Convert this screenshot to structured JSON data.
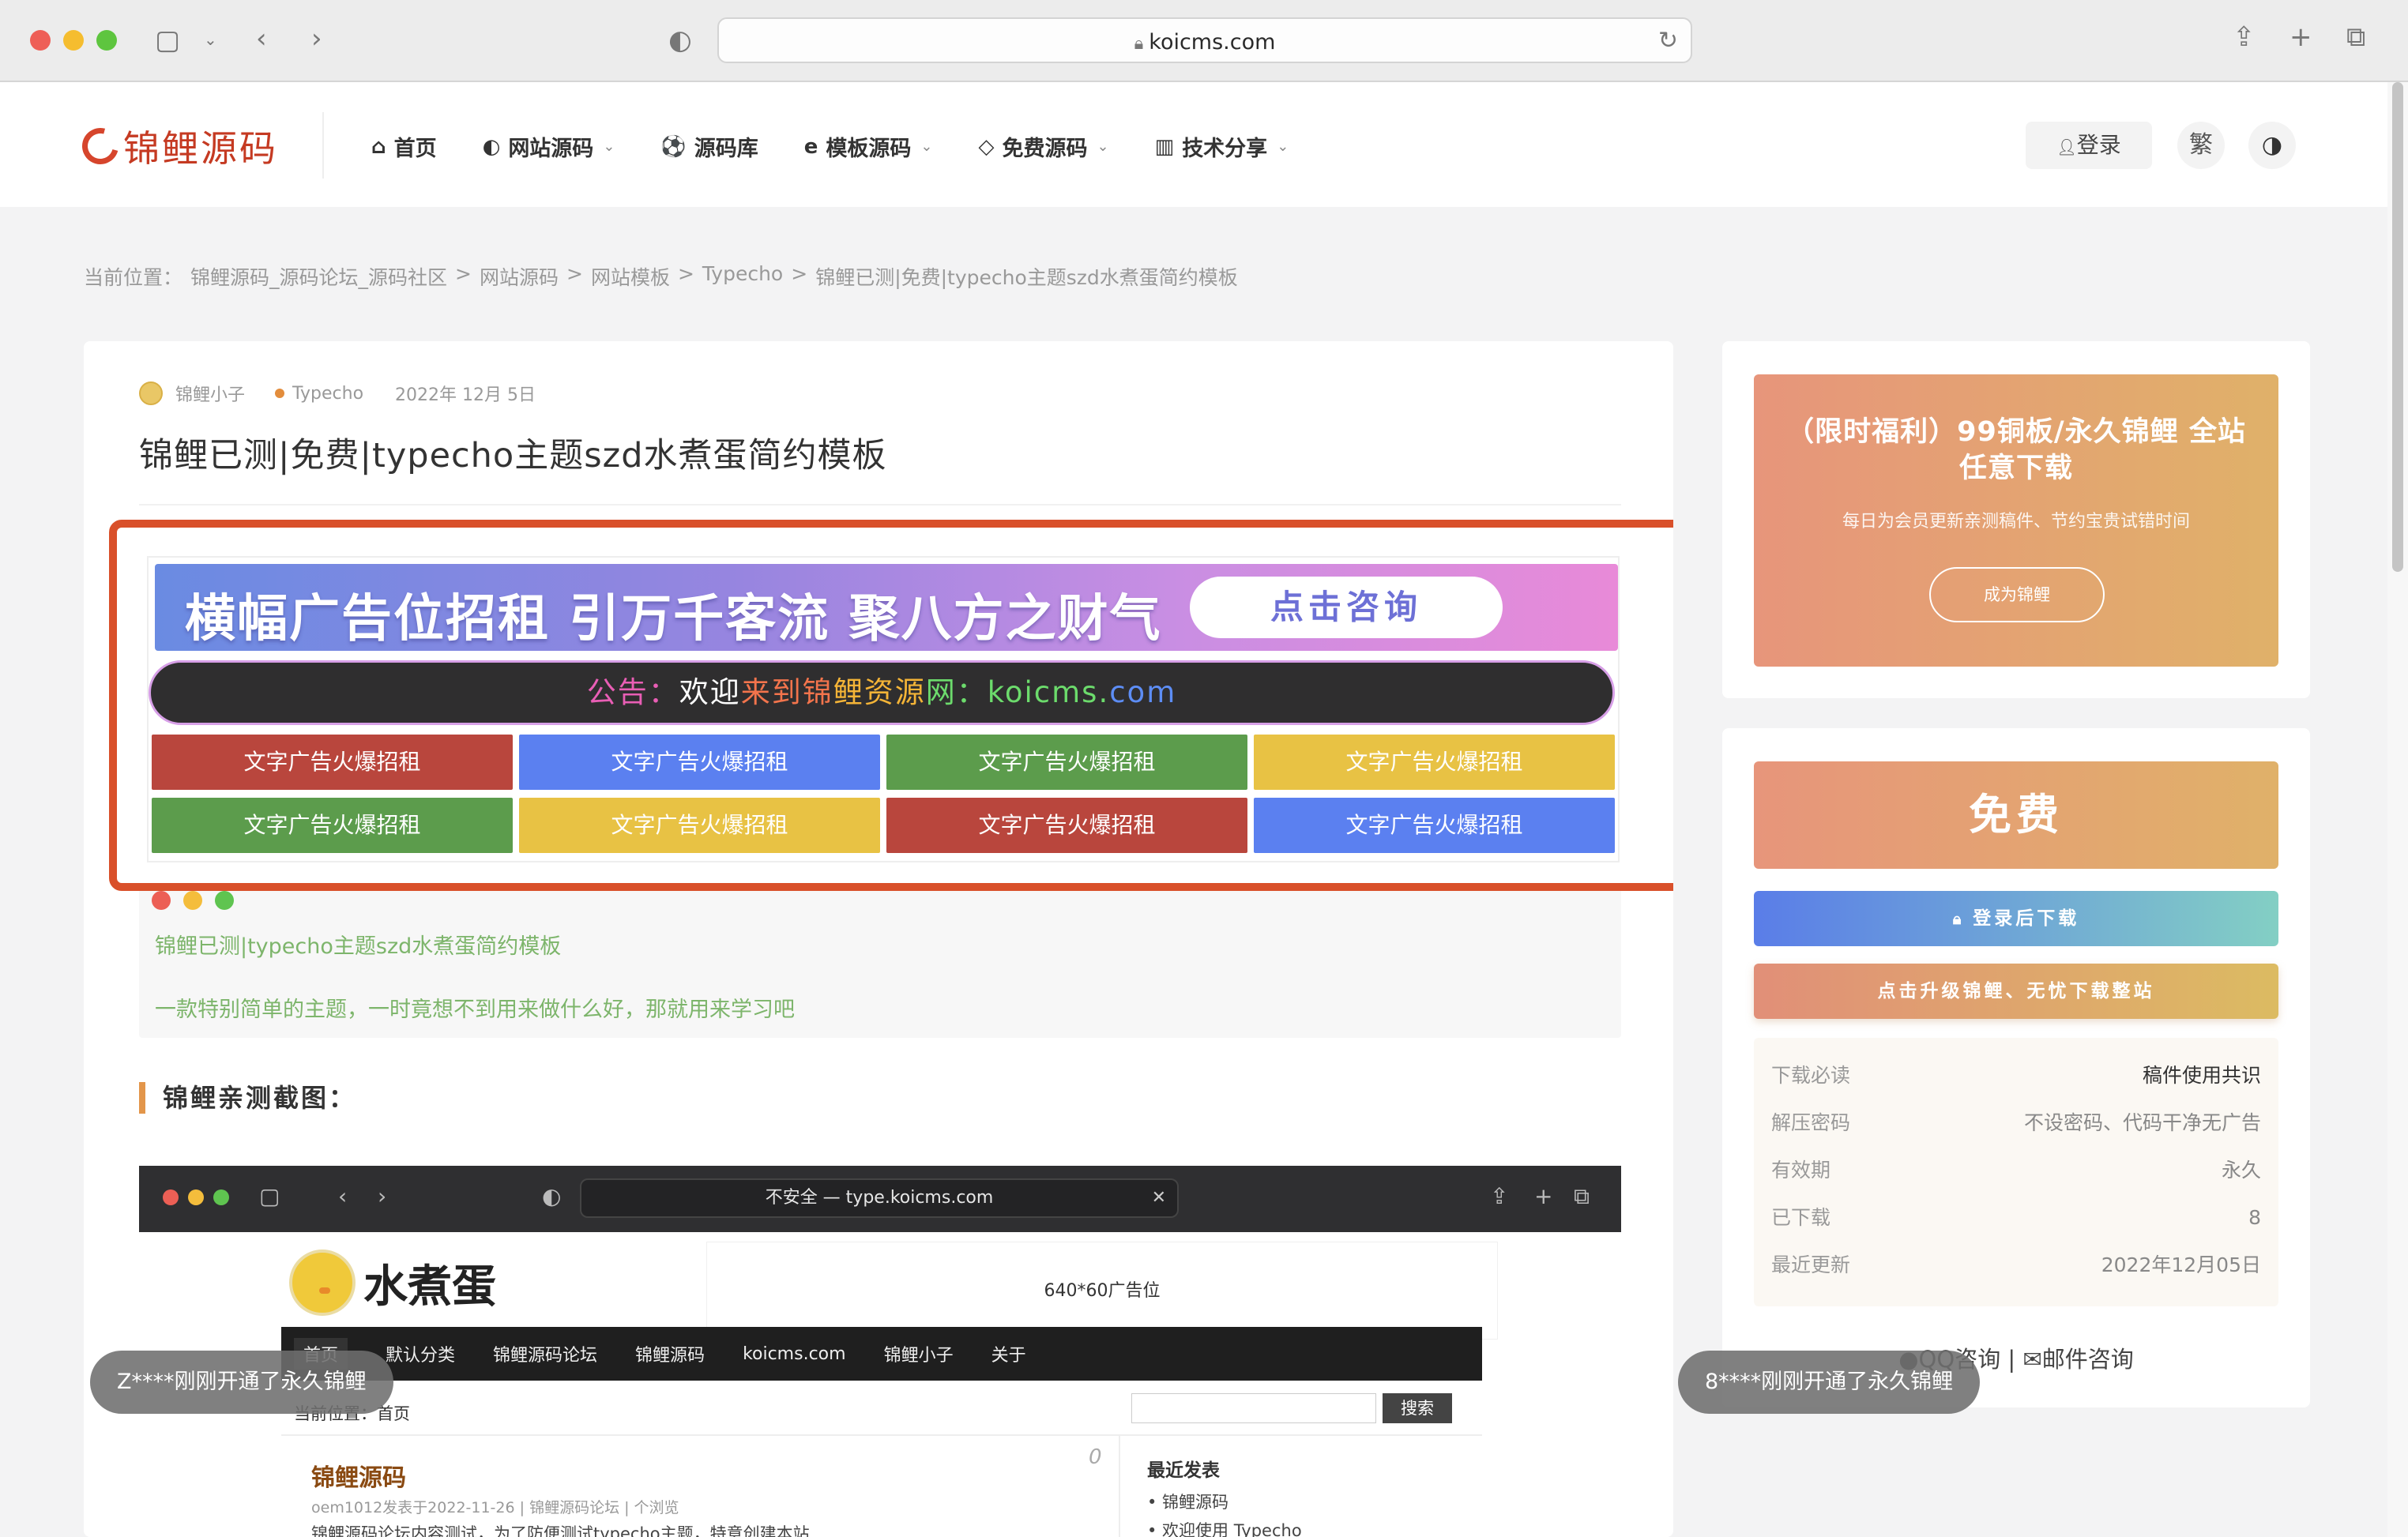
{
  "browser": {
    "url": "koicms.com"
  },
  "site": {
    "logo_text": "锦鲤源码",
    "nav": [
      {
        "icon": "⌂",
        "label": "首页",
        "has_caret": false
      },
      {
        "icon": "◐",
        "label": "网站源码",
        "has_caret": true
      },
      {
        "icon": "⚽",
        "label": "源码库",
        "has_caret": false
      },
      {
        "icon": "e",
        "label": "模板源码",
        "has_caret": true
      },
      {
        "icon": "◇",
        "label": "免费源码",
        "has_caret": true
      },
      {
        "icon": "▥",
        "label": "技术分享",
        "has_caret": true
      }
    ],
    "login": "登录",
    "traditional": "繁"
  },
  "breadcrumb": {
    "prefix": "当前位置：",
    "items": [
      "锦鲤源码_源码论坛_源码社区",
      "网站源码",
      "网站模板",
      "Typecho",
      "锦鲤已测|免费|typecho主题szd水煮蛋简约模板"
    ],
    "sep": ">"
  },
  "post": {
    "author": "锦鲤小子",
    "category": "Typecho",
    "date": "2022年 12月 5日",
    "title": "锦鲤已测|免费|typecho主题szd水煮蛋简约模板",
    "intro1": "锦鲤已测|typecho主题szd水煮蛋简约模板",
    "intro2": "一款特别简单的主题，一时竟想不到用来做什么好，那就用来学习吧",
    "section_heading": "锦鲤亲测截图："
  },
  "ads": {
    "banner_text": "横幅广告位招租 引万千客流 聚八方之财气",
    "banner_button": "点击咨询",
    "notice_label": "公告：",
    "notice_text": "欢迎来到锦鲤资源网：koicms.com",
    "text_ads": [
      {
        "label": "文字广告火爆招租",
        "color": "#b9463d"
      },
      {
        "label": "文字广告火爆招租",
        "color": "#5b80f0"
      },
      {
        "label": "文字广告火爆招租",
        "color": "#5c9c4c"
      },
      {
        "label": "文字广告火爆招租",
        "color": "#e8c244"
      },
      {
        "label": "文字广告火爆招租",
        "color": "#5c9c4c"
      },
      {
        "label": "文字广告火爆招租",
        "color": "#e8c244"
      },
      {
        "label": "文字广告火爆招租",
        "color": "#b9463d"
      },
      {
        "label": "文字广告火爆招租",
        "color": "#5b80f0"
      }
    ]
  },
  "screenshot": {
    "url": "不安全 — type.koicms.com",
    "logo": "水煮蛋",
    "ad_slot": "640*60广告位",
    "nav": [
      "首页",
      "默认分类",
      "锦鲤源码论坛",
      "锦鲤源码",
      "koicms.com",
      "锦鲤小子",
      "关于"
    ],
    "crumb": "当前位置：首页",
    "search_button": "搜索",
    "post_title": "锦鲤源码",
    "comment_count": "0",
    "post_meta": "oem1012发表于2022-11-26 | 锦鲤源码论坛 | 个浏览",
    "post_body": "锦鲤源码论坛内容测试，为了防便测试typecho主题，特意创建本站",
    "recent_heading": "最近发表",
    "recent_items": [
      "• 锦鲤源码",
      "• 欢迎使用 Typecho"
    ]
  },
  "sidebar": {
    "vip_title": "（限时福利）99铜板/永久锦鲤 全站任意下载",
    "vip_subtitle": "每日为会员更新亲测稿件、节约宝贵试错时间",
    "vip_button": "成为锦鲤",
    "price": "免费",
    "download_button": "登录后下载",
    "upgrade_button": "点击升级锦鲤、无忧下载整站",
    "info": [
      {
        "label": "下载必读",
        "value": "稿件使用共识"
      },
      {
        "label": "解压密码",
        "value": "不设密码、代码干净无广告"
      },
      {
        "label": "有效期",
        "value": "永久"
      },
      {
        "label": "已下载",
        "value": "8"
      },
      {
        "label": "最近更新",
        "value": "2022年12月05日"
      }
    ],
    "contact_qq": "QQ咨询",
    "contact_sep": "|",
    "contact_mail": "邮件咨询"
  },
  "toasts": {
    "left": "Z****刚刚开通了永久锦鲤",
    "right": "8****刚刚开通了永久锦鲤"
  }
}
